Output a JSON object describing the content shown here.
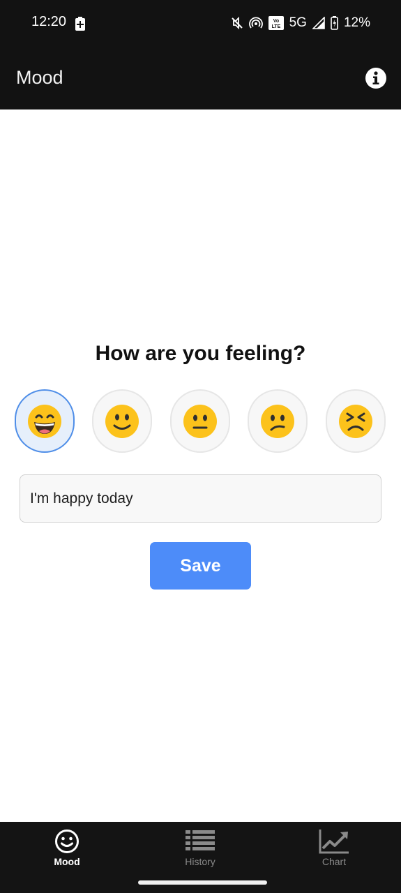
{
  "status_bar": {
    "time": "12:20",
    "network": "5G",
    "volte": "Vo LTE",
    "battery": "12%",
    "icons": [
      "battery-charging-icon",
      "mute-icon",
      "hotspot-icon",
      "volte-icon",
      "signal-icon",
      "battery-icon"
    ]
  },
  "app_bar": {
    "title": "Mood",
    "info_icon": "info-icon"
  },
  "main": {
    "question": "How are you feeling?",
    "moods": [
      {
        "name": "grinning-face-emoji",
        "selected": true
      },
      {
        "name": "slightly-smiling-face-emoji",
        "selected": false
      },
      {
        "name": "neutral-face-emoji",
        "selected": false
      },
      {
        "name": "confused-face-emoji",
        "selected": false
      },
      {
        "name": "persevering-face-emoji",
        "selected": false
      }
    ],
    "note_value": "I'm happy today",
    "save_label": "Save"
  },
  "bottom_nav": {
    "items": [
      {
        "label": "Mood",
        "icon": "smiley-icon",
        "active": true
      },
      {
        "label": "History",
        "icon": "list-icon",
        "active": false
      },
      {
        "label": "Chart",
        "icon": "chart-icon",
        "active": false
      }
    ]
  },
  "colors": {
    "bar_background": "#121212",
    "accent": "#4d8cf9",
    "selected_border": "#4f8ee8",
    "emoji_yellow": "#fcc21b"
  }
}
